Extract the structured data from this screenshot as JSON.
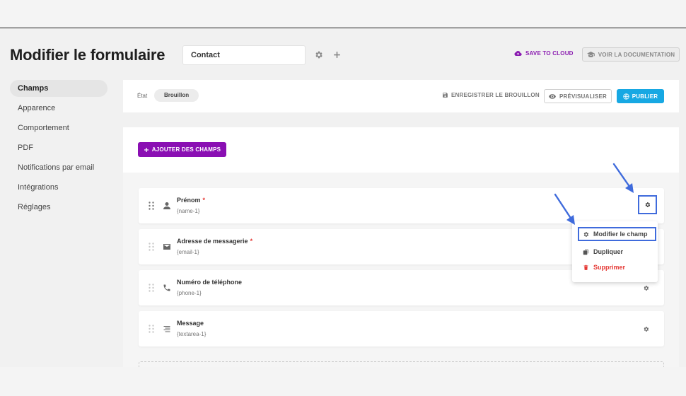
{
  "header": {
    "title": "Modifier le formulaire",
    "form_name": "Contact",
    "save_cloud": "SAVE TO CLOUD",
    "docs": "VOIR LA DOCUMENTATION"
  },
  "sidebar": {
    "items": [
      {
        "label": "Champs",
        "active": true
      },
      {
        "label": "Apparence"
      },
      {
        "label": "Comportement"
      },
      {
        "label": "PDF"
      },
      {
        "label": "Notifications par email"
      },
      {
        "label": "Intégrations"
      },
      {
        "label": "Réglages"
      }
    ]
  },
  "status_bar": {
    "state_label": "État",
    "state_value": "Brouillon",
    "save_draft": "ENREGISTRER LE BROUILLON",
    "preview": "PRÉVISUALISER",
    "publish": "PUBLIER"
  },
  "fields_panel": {
    "add_button": "AJOUTER DES CHAMPS",
    "fields": [
      {
        "label": "Prénom",
        "required": "*",
        "id": "{name-1}",
        "icon": "user-icon"
      },
      {
        "label": "Adresse de messagerie",
        "required": "*",
        "id": "{email-1}",
        "icon": "envelope-icon"
      },
      {
        "label": "Numéro de téléphone",
        "required": "",
        "id": "{phone-1}",
        "icon": "phone-icon"
      },
      {
        "label": "Message",
        "required": "",
        "id": "{textarea-1}",
        "icon": "textarea-icon"
      }
    ]
  },
  "context_menu": {
    "items": [
      {
        "label": "Modifier le champ",
        "icon": "gear-icon"
      },
      {
        "label": "Dupliquer",
        "icon": "copy-icon"
      },
      {
        "label": "Supprimer",
        "icon": "trash-icon"
      }
    ]
  },
  "colors": {
    "accent_purple": "#8a0fb3",
    "publish_blue": "#17a8e3",
    "highlight_blue": "#3f6bdc",
    "danger_red": "#e53935"
  }
}
